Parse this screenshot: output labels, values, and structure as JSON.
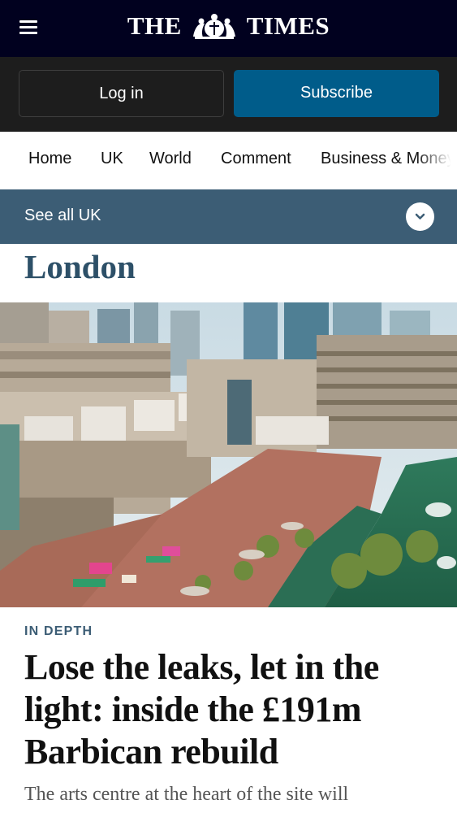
{
  "header": {
    "logo_left": "THE",
    "logo_right": "TIMES",
    "menu_icon": "hamburger-menu-icon",
    "crest_icon": "royal-crest-icon",
    "background": "#01011f"
  },
  "auth": {
    "login_label": "Log in",
    "subscribe_label": "Subscribe",
    "subscribe_color": "#005c8a"
  },
  "nav": {
    "items": [
      "Home",
      "UK",
      "World",
      "Comment",
      "Business & Money"
    ]
  },
  "section_bar": {
    "label": "See all UK",
    "icon": "chevron-down-icon",
    "background": "#3c5d75"
  },
  "section": {
    "title": "London"
  },
  "article": {
    "kicker": "IN DEPTH",
    "headline": "Lose the leaks, let in the light: inside the £191m Barbican rebuild",
    "standfirst": "The arts centre at the heart of the site will"
  }
}
